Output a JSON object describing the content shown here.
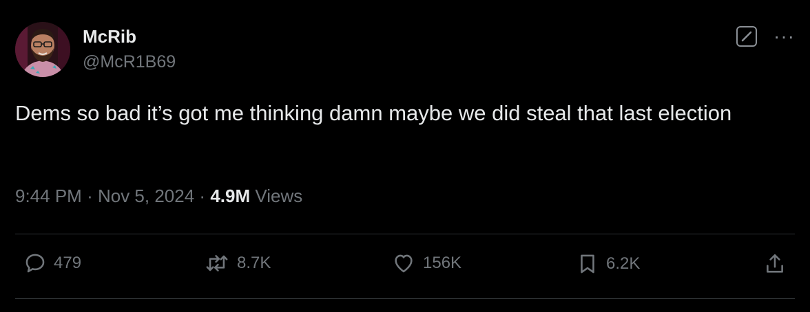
{
  "author": {
    "display_name": "McRib",
    "handle": "@McR1B69"
  },
  "tweet": {
    "text": "Dems so bad it’s got me thinking damn maybe we did steal that last election",
    "time": "9:44 PM",
    "separator": "·",
    "date": "Nov 5, 2024",
    "views_count": "4.9M",
    "views_label": "Views"
  },
  "engagement": {
    "replies": "479",
    "reposts": "8.7K",
    "likes": "156K",
    "bookmarks": "6.2K"
  },
  "icons": {
    "grok": "grok-icon",
    "more": "more-icon",
    "reply": "reply-icon",
    "repost": "repost-icon",
    "like": "heart-icon",
    "bookmark": "bookmark-icon",
    "share": "share-icon"
  },
  "colors": {
    "background": "#000000",
    "primary_text": "#e7e9ea",
    "secondary_text": "#71767b",
    "divider": "#2f3336"
  }
}
